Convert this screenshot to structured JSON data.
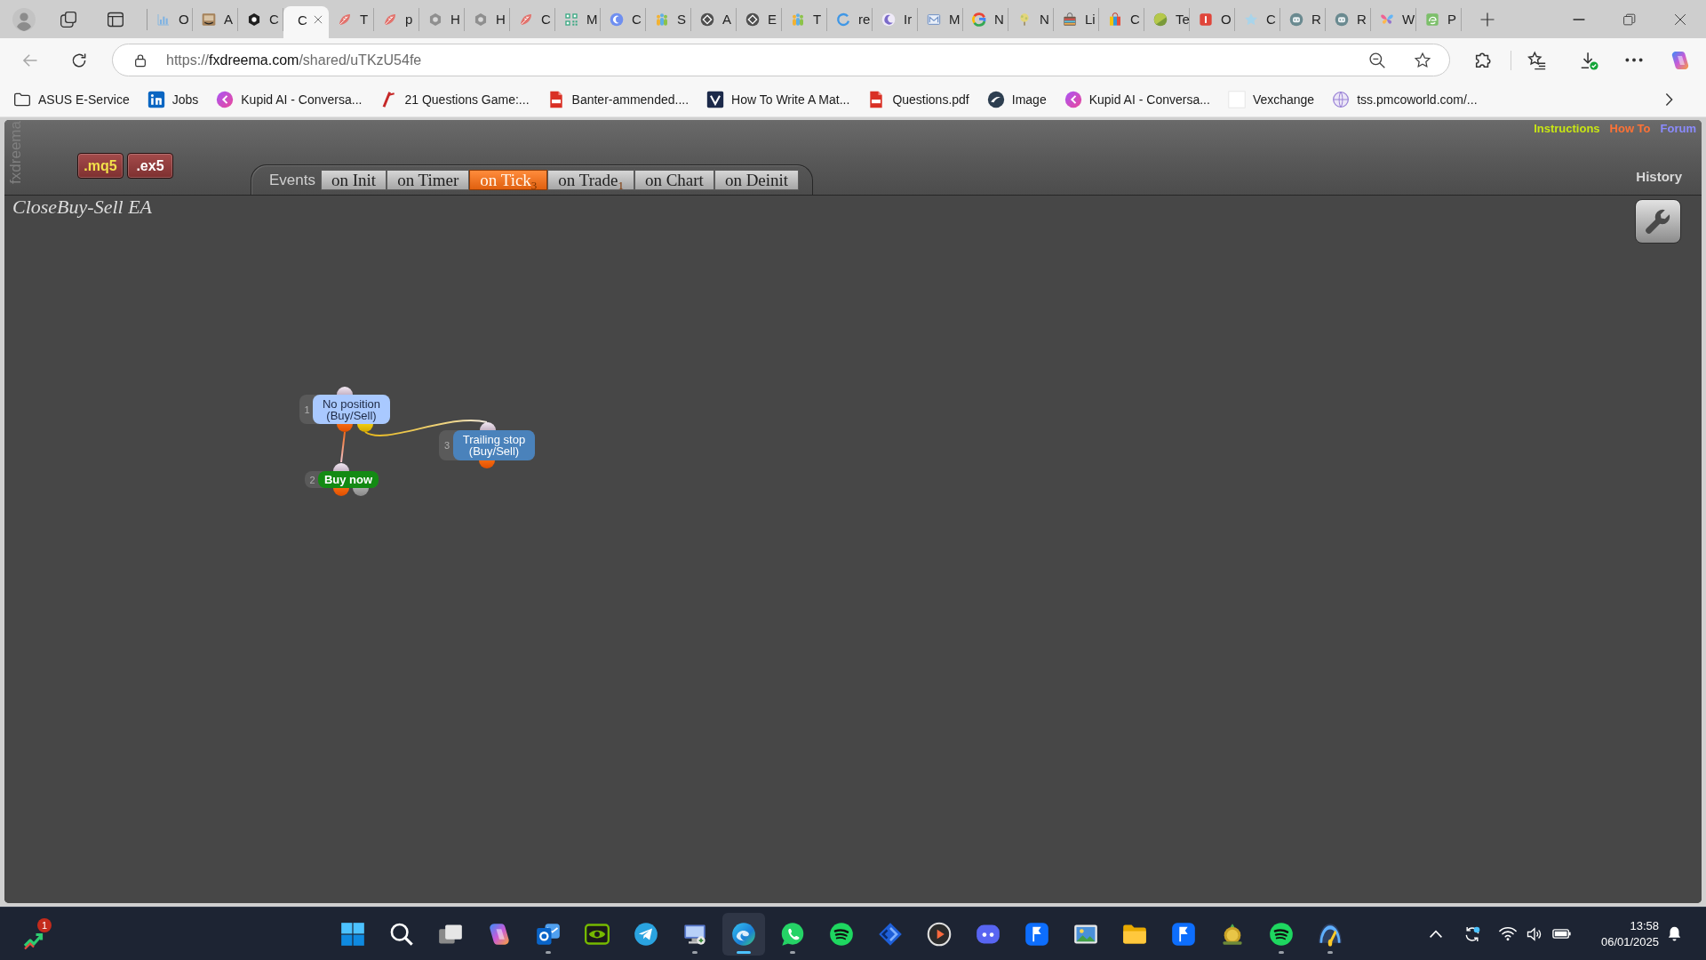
{
  "browser": {
    "tabs": [
      {
        "title": "O",
        "selected": false
      },
      {
        "title": "A",
        "selected": false
      },
      {
        "title": "C",
        "selected": false
      },
      {
        "title": "C",
        "selected": true
      },
      {
        "title": "T",
        "selected": false
      },
      {
        "title": "p",
        "selected": false
      },
      {
        "title": "H",
        "selected": false
      },
      {
        "title": "H",
        "selected": false
      },
      {
        "title": "C",
        "selected": false
      },
      {
        "title": "M",
        "selected": false
      },
      {
        "title": "C",
        "selected": false
      },
      {
        "title": "S",
        "selected": false
      },
      {
        "title": "A",
        "selected": false
      },
      {
        "title": "E",
        "selected": false
      },
      {
        "title": "T",
        "selected": false
      },
      {
        "title": "re",
        "selected": false
      },
      {
        "title": "Ir",
        "selected": false
      },
      {
        "title": "M",
        "selected": false
      },
      {
        "title": "N",
        "selected": false
      },
      {
        "title": "N",
        "selected": false
      },
      {
        "title": "Li",
        "selected": false
      },
      {
        "title": "C",
        "selected": false
      },
      {
        "title": "Te",
        "selected": false
      },
      {
        "title": "O",
        "selected": false
      },
      {
        "title": "C",
        "selected": false
      },
      {
        "title": "R",
        "selected": false
      },
      {
        "title": "R",
        "selected": false
      },
      {
        "title": "W",
        "selected": false
      },
      {
        "title": "P",
        "selected": false
      }
    ],
    "address_bar": {
      "url": "https://fxdreema.com/shared/uTKzU54fe"
    },
    "bookmarks": [
      "ASUS E-Service",
      "Jobs",
      "Kupid AI - Conversa...",
      "21 Questions Game:...",
      "Banter-ammended....",
      "How To Write A Mat...",
      "Questions.pdf",
      "Image",
      "Kupid AI - Conversa...",
      "Vexchange",
      "tss.pmcoworld.com/..."
    ]
  },
  "app": {
    "side_label": "fxdreema",
    "export_buttons": [
      {
        "label": ".mq5",
        "color": "#f2e04a"
      },
      {
        "label": ".ex5",
        "color": "#ffffff"
      }
    ],
    "header_links": [
      {
        "label": "Instructions",
        "color": "#c8e614"
      },
      {
        "label": "How To",
        "color": "#ff7236"
      },
      {
        "label": "Forum",
        "color": "#8b8bff"
      }
    ],
    "events_label": "Events",
    "event_tabs": [
      {
        "label": "on Init",
        "selected": false
      },
      {
        "label": "on Timer",
        "selected": false
      },
      {
        "label": "on Tick$_{3}$",
        "selected": true
      },
      {
        "label": "on Trade$_{1}$",
        "selected": false
      },
      {
        "label": "on Chart",
        "selected": false
      },
      {
        "label": "on Deinit",
        "selected": false
      }
    ],
    "history_label": "History",
    "project_title": "CloseBuy-Sell EA",
    "blocks": [
      {
        "number": "1",
        "label": "No position (Buy/Sell)",
        "kind": "condition"
      },
      {
        "number": "2",
        "label": "Buy now",
        "kind": "action"
      },
      {
        "number": "3",
        "label": "Trailing stop (Buy/Sell)",
        "kind": "modifier"
      }
    ]
  },
  "taskbar": {
    "widget_badge": "1",
    "apps": [
      {
        "running": false,
        "selected": false
      },
      {
        "running": false,
        "selected": false
      },
      {
        "running": false,
        "selected": false
      },
      {
        "running": false,
        "selected": false
      },
      {
        "running": true,
        "selected": false
      },
      {
        "running": false,
        "selected": false
      },
      {
        "running": false,
        "selected": false
      },
      {
        "running": true,
        "selected": false
      },
      {
        "running": true,
        "selected": true
      },
      {
        "running": true,
        "selected": false
      },
      {
        "running": false,
        "selected": false
      },
      {
        "running": false,
        "selected": false
      },
      {
        "running": false,
        "selected": false
      },
      {
        "running": false,
        "selected": false
      },
      {
        "running": false,
        "selected": false
      },
      {
        "running": false,
        "selected": false
      },
      {
        "running": false,
        "selected": false
      },
      {
        "running": false,
        "selected": false
      },
      {
        "running": false,
        "selected": false
      },
      {
        "running": true,
        "selected": false
      },
      {
        "running": true,
        "selected": false
      }
    ],
    "clock": {
      "time": "13:58",
      "date": "06/01/2025"
    }
  }
}
